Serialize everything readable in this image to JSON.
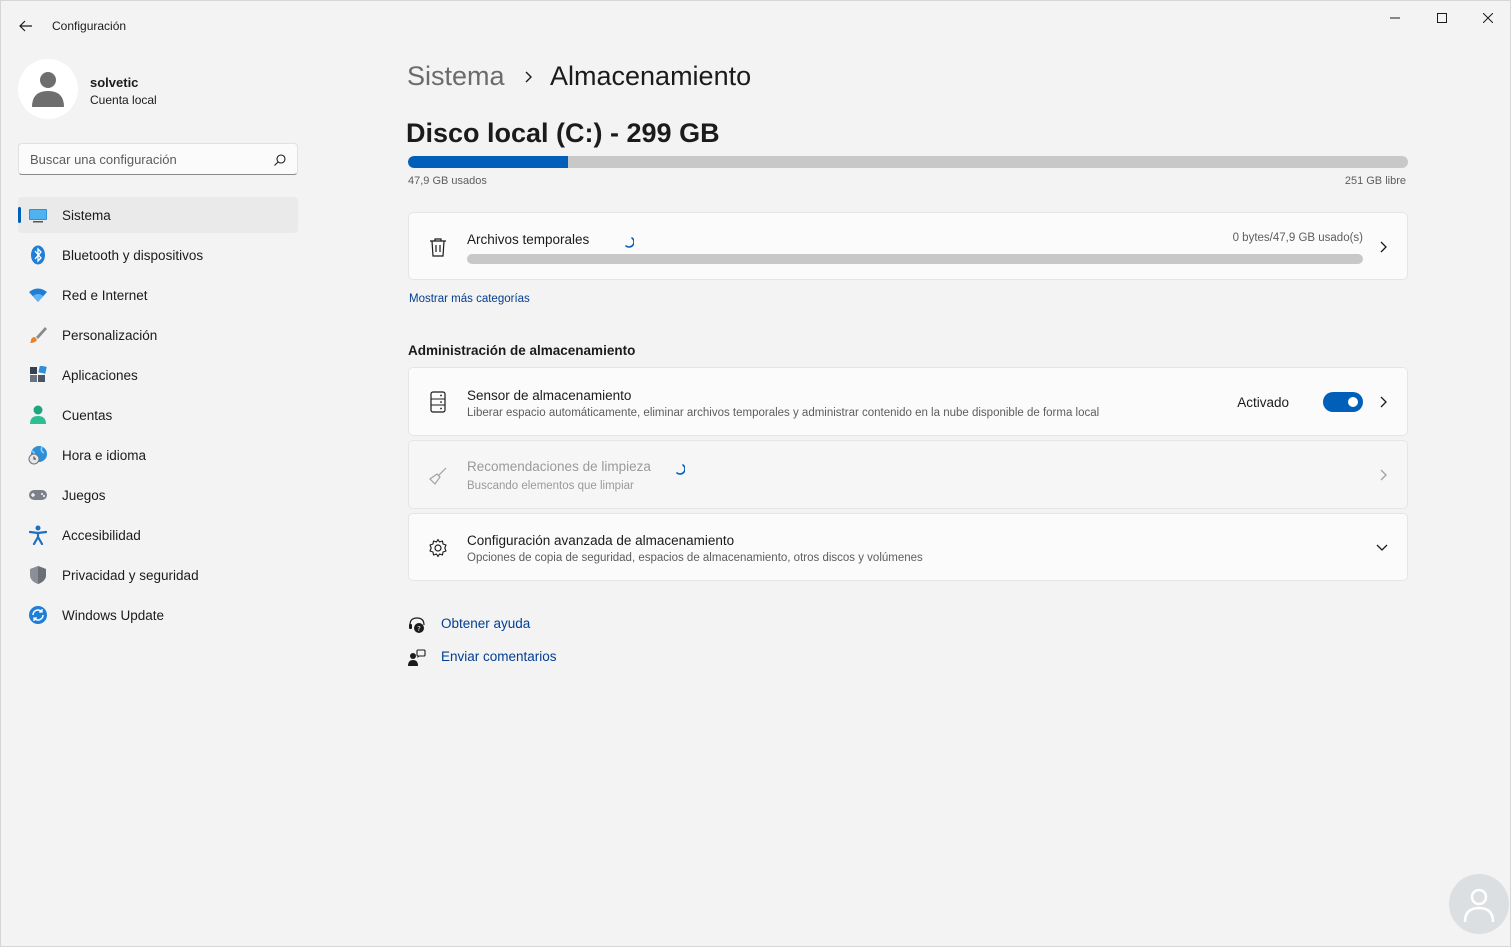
{
  "window": {
    "title": "Configuración"
  },
  "user": {
    "name": "solvetic",
    "account_type": "Cuenta local"
  },
  "search": {
    "placeholder": "Buscar una configuración"
  },
  "sidebar": {
    "items": [
      {
        "label": "Sistema",
        "icon": "system-monitor-icon",
        "active": true
      },
      {
        "label": "Bluetooth y dispositivos",
        "icon": "bluetooth-icon"
      },
      {
        "label": "Red e Internet",
        "icon": "wifi-icon"
      },
      {
        "label": "Personalización",
        "icon": "paintbrush-icon"
      },
      {
        "label": "Aplicaciones",
        "icon": "apps-icon"
      },
      {
        "label": "Cuentas",
        "icon": "person-icon"
      },
      {
        "label": "Hora e idioma",
        "icon": "globe-clock-icon"
      },
      {
        "label": "Juegos",
        "icon": "gamepad-icon"
      },
      {
        "label": "Accesibilidad",
        "icon": "accessibility-icon"
      },
      {
        "label": "Privacidad y seguridad",
        "icon": "shield-icon"
      },
      {
        "label": "Windows Update",
        "icon": "update-icon"
      }
    ]
  },
  "breadcrumb": {
    "parent": "Sistema",
    "current": "Almacenamiento"
  },
  "disk": {
    "title": "Disco local (C:) - 299 GB",
    "used_label": "47,9 GB usados",
    "free_label": "251 GB libre",
    "used_fraction": 0.16,
    "accent": "#005fb8"
  },
  "temp_files": {
    "title": "Archivos temporales",
    "usage": "0 bytes/47,9 GB usado(s)"
  },
  "more_categories": "Mostrar más categorías",
  "management": {
    "section_title": "Administración de almacenamiento",
    "sensor": {
      "title": "Sensor de almacenamiento",
      "subtitle": "Liberar espacio automáticamente, eliminar archivos temporales y administrar contenido en la nube disponible de forma local",
      "status": "Activado",
      "enabled": true
    },
    "cleanup": {
      "title": "Recomendaciones de limpieza",
      "subtitle": "Buscando elementos que limpiar"
    },
    "advanced": {
      "title": "Configuración avanzada de almacenamiento",
      "subtitle": "Opciones de copia de seguridad, espacios de almacenamiento, otros discos y volúmenes"
    }
  },
  "help": {
    "get_help": "Obtener ayuda",
    "feedback": "Enviar comentarios"
  }
}
